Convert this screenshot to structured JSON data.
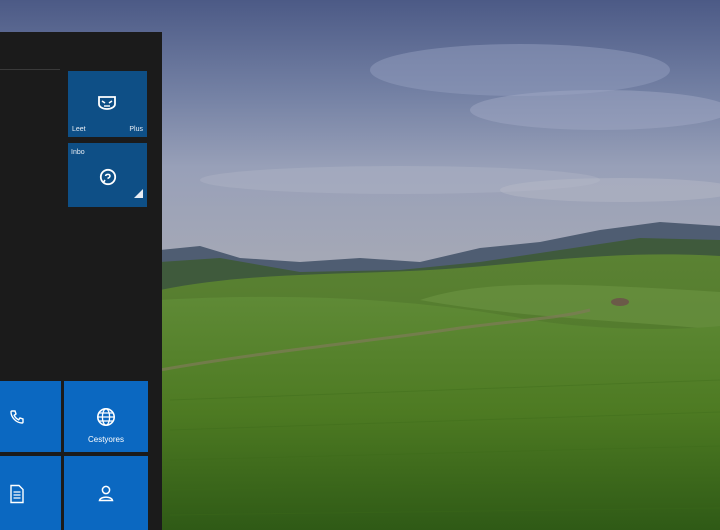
{
  "start_menu": {
    "tiles": [
      {
        "id": "tile-mail",
        "icon": "mask-icon",
        "label_left": "Leet",
        "label_right": "Plus"
      },
      {
        "id": "tile-messages",
        "icon": "chat-icon",
        "label_top": "Inbo",
        "badge": "signal-icon"
      },
      {
        "id": "tile-phone",
        "icon": "phone-icon"
      },
      {
        "id": "tile-globe",
        "icon": "globe-icon",
        "label": "Cestyores"
      },
      {
        "id": "tile-document",
        "icon": "document-icon"
      },
      {
        "id": "tile-people",
        "icon": "person-icon"
      }
    ]
  },
  "colors": {
    "panel": "#1b1b1b",
    "tile_dark": "#0e4f86",
    "tile_blue": "#0b68c1"
  }
}
